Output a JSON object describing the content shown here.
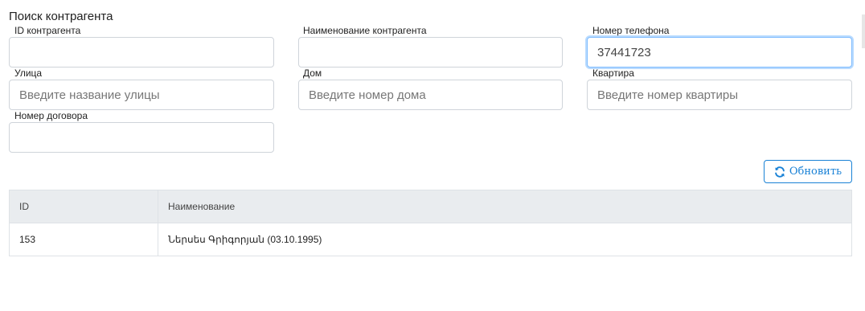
{
  "page": {
    "title": "Поиск контрагента"
  },
  "form": {
    "counterparty_id": {
      "label": "ID контрагента",
      "value": "",
      "placeholder": ""
    },
    "counterparty_name": {
      "label": "Наименование контрагента",
      "value": "",
      "placeholder": ""
    },
    "phone": {
      "label": "Номер телефона",
      "value": "37441723",
      "placeholder": ""
    },
    "street": {
      "label": "Улица",
      "value": "",
      "placeholder": "Введите название улицы"
    },
    "house": {
      "label": "Дом",
      "value": "",
      "placeholder": "Введите номер дома"
    },
    "apartment": {
      "label": "Квартира",
      "value": "",
      "placeholder": "Введите номер квартиры"
    },
    "contract": {
      "label": "Номер договора",
      "value": "",
      "placeholder": ""
    }
  },
  "refresh_button": {
    "label": "Обновить",
    "icon": "refresh-icon",
    "color": "#1a82d6"
  },
  "table": {
    "columns": [
      "ID",
      "Наименование"
    ],
    "rows": [
      [
        "153",
        "Ներսես Գրիգորյան (03.10.1995)"
      ]
    ]
  }
}
